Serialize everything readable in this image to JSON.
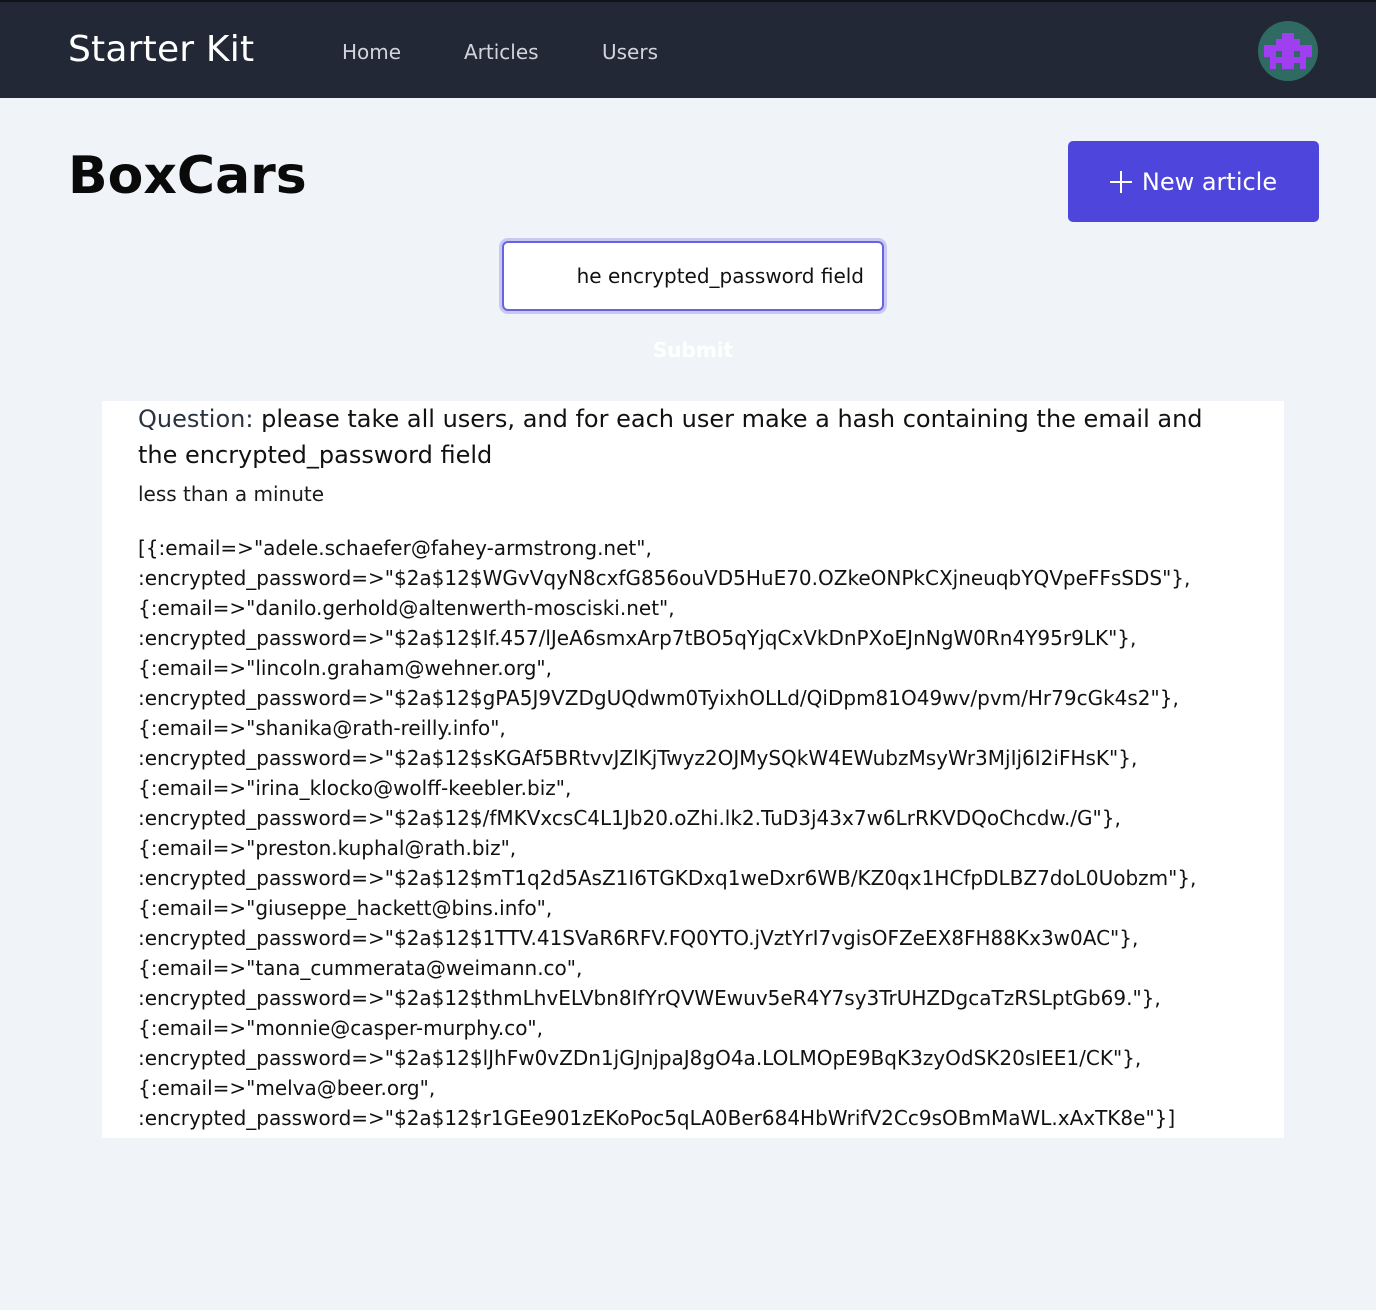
{
  "navbar": {
    "brand": "Starter Kit",
    "links": [
      {
        "label": "Home"
      },
      {
        "label": "Articles"
      },
      {
        "label": "Users"
      }
    ],
    "avatar": {
      "icon": "identicon-avatar",
      "bg_color": "#2f6b63",
      "fg_color": "#a03ff0"
    }
  },
  "page": {
    "title": "BoxCars",
    "new_article_button": {
      "icon": "plus-icon",
      "label": "New article"
    },
    "accent_color": "#4e46dc"
  },
  "form": {
    "question_value": "please take all users, and for each user make a hash containing the email and the encrypted_password field",
    "visible_input_text": "he encrypted_password field",
    "submit_label": "Submit"
  },
  "result": {
    "question_label": "Question:",
    "question_text": "please take all users, and for each user make a hash containing the email and the encrypted_password field",
    "elapsed": "less than a minute",
    "lines": [
      "[{:email=>\"adele.schaefer@fahey-armstrong.net\",",
      ":encrypted_password=>\"$2a$12$WGvVqyN8cxfG856ouVD5HuE70.OZkeONPkCXjneuqbYQVpeFFsSDS\"},",
      "{:email=>\"danilo.gerhold@altenwerth-mosciski.net\",",
      ":encrypted_password=>\"$2a$12$If.457/lJeA6smxArp7tBO5qYjqCxVkDnPXoEJnNgW0Rn4Y95r9LK\"},",
      "{:email=>\"lincoln.graham@wehner.org\",",
      ":encrypted_password=>\"$2a$12$gPA5J9VZDgUQdwm0TyixhOLLd/QiDpm81O49wv/pvm/Hr79cGk4s2\"},",
      "{:email=>\"shanika@rath-reilly.info\",",
      ":encrypted_password=>\"$2a$12$sKGAf5BRtvvJZlKjTwyz2OJMySQkW4EWubzMsyWr3MjIj6I2iFHsK\"},",
      "{:email=>\"irina_klocko@wolff-keebler.biz\",",
      ":encrypted_password=>\"$2a$12$/fMKVxcsC4L1Jb20.oZhi.lk2.TuD3j43x7w6LrRKVDQoChcdw./G\"},",
      "{:email=>\"preston.kuphal@rath.biz\",",
      ":encrypted_password=>\"$2a$12$mT1q2d5AsZ1I6TGKDxq1weDxr6WB/KZ0qx1HCfpDLBZ7doL0Uobzm\"},",
      "{:email=>\"giuseppe_hackett@bins.info\",",
      ":encrypted_password=>\"$2a$12$1TTV.41SVaR6RFV.FQ0YTO.jVztYrI7vgisOFZeEX8FH88Kx3w0AC\"},",
      "{:email=>\"tana_cummerata@weimann.co\",",
      ":encrypted_password=>\"$2a$12$thmLhvELVbn8IfYrQVWEwuv5eR4Y7sy3TrUHZDgcaTzRSLptGb69.\"},",
      "{:email=>\"monnie@casper-murphy.co\",",
      ":encrypted_password=>\"$2a$12$lJhFw0vZDn1jGJnjpaJ8gO4a.LOLMOpE9BqK3zyOdSK20sIEE1/CK\"},",
      "{:email=>\"melva@beer.org\",",
      ":encrypted_password=>\"$2a$12$r1GEe901zEKoPoc5qLA0Ber684HbWrifV2Cc9sOBmMaWL.xAxTK8e\"}]"
    ]
  }
}
